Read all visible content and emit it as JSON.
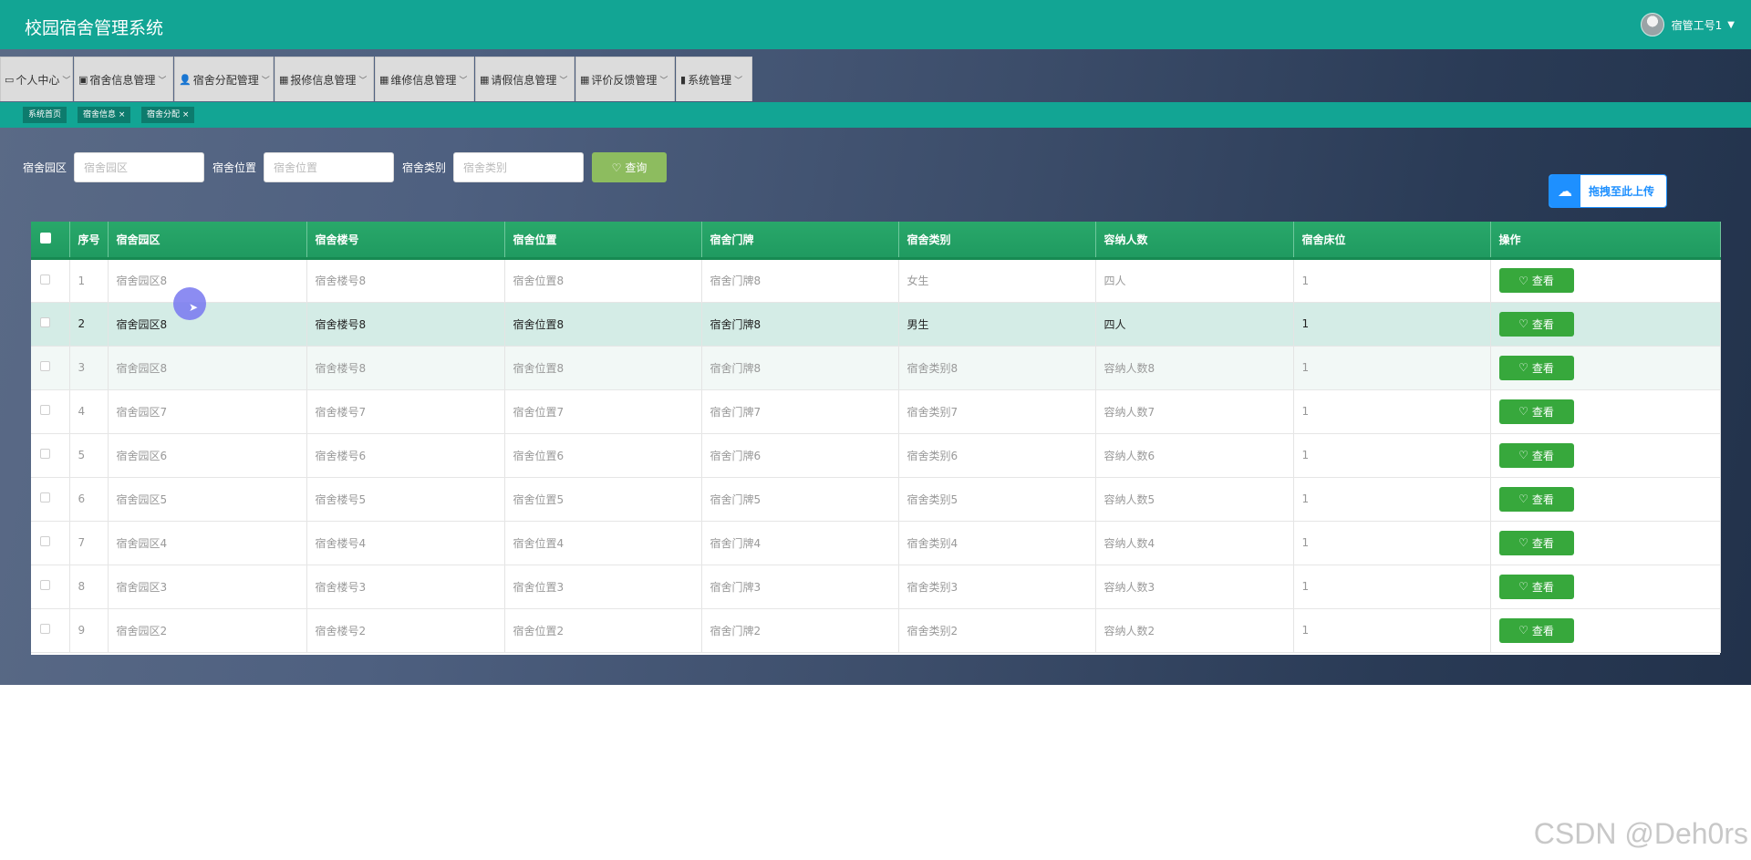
{
  "header": {
    "title": "校园宿舍管理系统",
    "user": "宿管工号1"
  },
  "menu": [
    {
      "icon": "calendar-icon",
      "glyph": "▭",
      "label": "个人中心"
    },
    {
      "icon": "clipboard-icon",
      "glyph": "▣",
      "label": "宿舍信息管理"
    },
    {
      "icon": "user-icon",
      "glyph": "👤",
      "label": "宿舍分配管理"
    },
    {
      "icon": "grid-icon",
      "glyph": "▦",
      "label": "报修信息管理"
    },
    {
      "icon": "grid-icon",
      "glyph": "▦",
      "label": "维修信息管理"
    },
    {
      "icon": "grid-icon",
      "glyph": "▦",
      "label": "请假信息管理"
    },
    {
      "icon": "grid-icon",
      "glyph": "▦",
      "label": "评价反馈管理"
    },
    {
      "icon": "bar-chart-icon",
      "glyph": "▮",
      "label": "系统管理"
    }
  ],
  "tabs": [
    {
      "label": "系统首页"
    },
    {
      "label": "宿舍信息 ×"
    },
    {
      "label": "宿舍分配 ×"
    }
  ],
  "search": {
    "fields": [
      {
        "label": "宿舍园区",
        "placeholder": "宿舍园区"
      },
      {
        "label": "宿舍位置",
        "placeholder": "宿舍位置"
      },
      {
        "label": "宿舍类别",
        "placeholder": "宿舍类别"
      }
    ],
    "button": "查询"
  },
  "upload": {
    "label": "拖拽至此上传"
  },
  "table": {
    "headers": [
      "序号",
      "宿舍园区",
      "宿舍楼号",
      "宿舍位置",
      "宿舍门牌",
      "宿舍类别",
      "容纳人数",
      "宿舍床位",
      "操作"
    ],
    "action_label": "查看",
    "rows": [
      [
        "1",
        "宿舍园区8",
        "宿舍楼号8",
        "宿舍位置8",
        "宿舍门牌8",
        "女生",
        "四人",
        "1"
      ],
      [
        "2",
        "宿舍园区8",
        "宿舍楼号8",
        "宿舍位置8",
        "宿舍门牌8",
        "男生",
        "四人",
        "1"
      ],
      [
        "3",
        "宿舍园区8",
        "宿舍楼号8",
        "宿舍位置8",
        "宿舍门牌8",
        "宿舍类别8",
        "容纳人数8",
        "1"
      ],
      [
        "4",
        "宿舍园区7",
        "宿舍楼号7",
        "宿舍位置7",
        "宿舍门牌7",
        "宿舍类别7",
        "容纳人数7",
        "1"
      ],
      [
        "5",
        "宿舍园区6",
        "宿舍楼号6",
        "宿舍位置6",
        "宿舍门牌6",
        "宿舍类别6",
        "容纳人数6",
        "1"
      ],
      [
        "6",
        "宿舍园区5",
        "宿舍楼号5",
        "宿舍位置5",
        "宿舍门牌5",
        "宿舍类别5",
        "容纳人数5",
        "1"
      ],
      [
        "7",
        "宿舍园区4",
        "宿舍楼号4",
        "宿舍位置4",
        "宿舍门牌4",
        "宿舍类别4",
        "容纳人数4",
        "1"
      ],
      [
        "8",
        "宿舍园区3",
        "宿舍楼号3",
        "宿舍位置3",
        "宿舍门牌3",
        "宿舍类别3",
        "容纳人数3",
        "1"
      ],
      [
        "9",
        "宿舍园区2",
        "宿舍楼号2",
        "宿舍位置2",
        "宿舍门牌2",
        "宿舍类别2",
        "容纳人数2",
        "1"
      ]
    ]
  },
  "watermark": "CSDN @Deh0rs",
  "colors": {
    "header": "#12a594",
    "table_header": "#22a064",
    "view_button": "#37a83c",
    "search_button": "#8dbc5f",
    "upload": "#1e90ff"
  }
}
